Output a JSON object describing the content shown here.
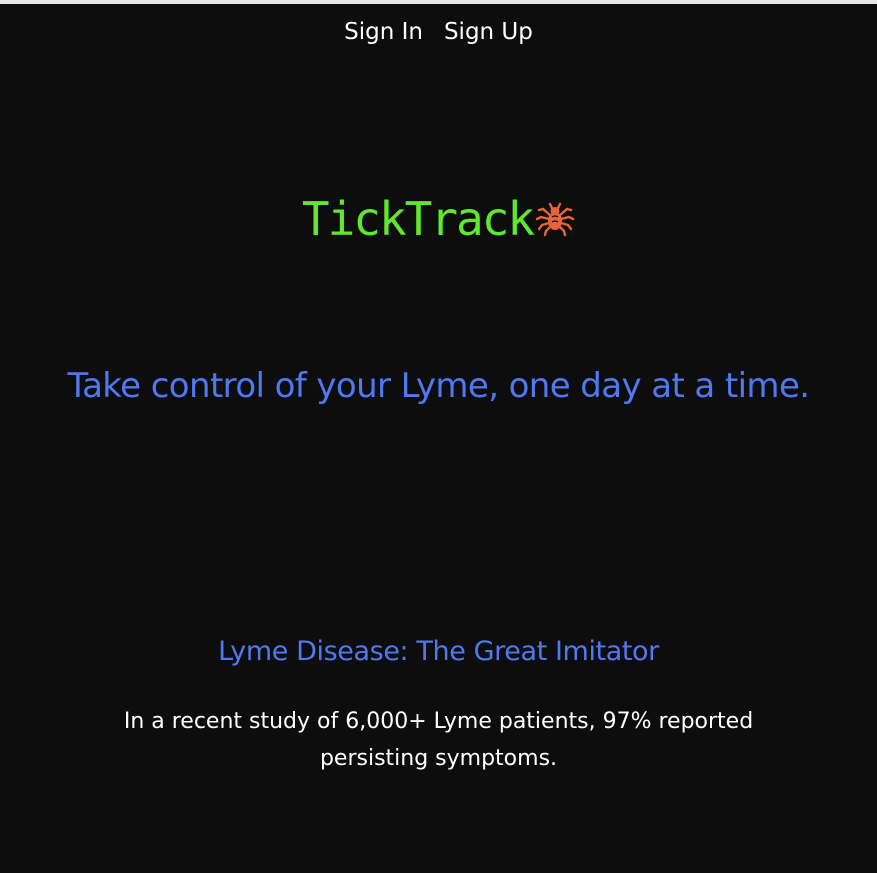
{
  "nav": {
    "sign_in": "Sign In",
    "sign_up": "Sign Up"
  },
  "brand": {
    "name": "TickTrack",
    "icon": "tick-icon",
    "name_color": "#5ee82e",
    "icon_color": "#e8633a"
  },
  "hero": {
    "tagline": "Take control of your Lyme, one day at a time."
  },
  "info": {
    "title": "Lyme Disease: The Great Imitator",
    "body": "In a recent study of 6,000+ Lyme patients, 97% reported persisting symptoms."
  },
  "colors": {
    "background": "#0d0d0d",
    "accent_blue": "#4f78f2",
    "text": "#ffffff"
  }
}
